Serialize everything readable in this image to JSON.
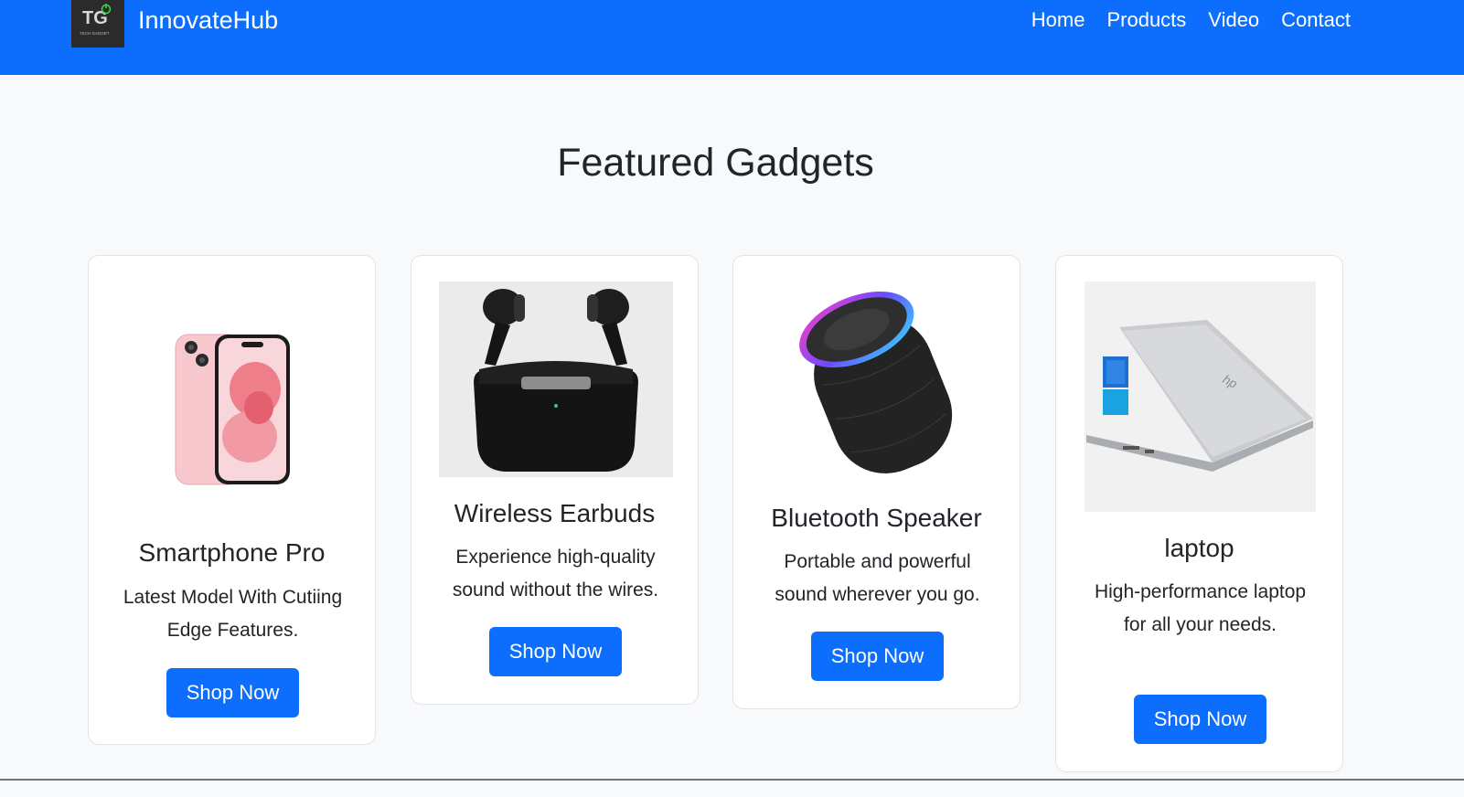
{
  "header": {
    "logo_text": "TG",
    "logo_subtext": "TECH GADGET",
    "brand": "InnovateHub",
    "nav": [
      "Home",
      "Products",
      "Video",
      "Contact"
    ]
  },
  "main": {
    "title": "Featured Gadgets",
    "cards": [
      {
        "title": "Smartphone Pro",
        "description": "Latest Model With Cutiing Edge Features.",
        "button": "Shop Now",
        "image": "pink-smartphone"
      },
      {
        "title": "Wireless Earbuds",
        "description": "Experience high-quality sound without the wires.",
        "button": "Shop Now",
        "image": "black-earbuds-case"
      },
      {
        "title": "Bluetooth Speaker",
        "description": "Portable and powerful sound wherever you go.",
        "button": "Shop Now",
        "image": "black-speaker-rgb-ring"
      },
      {
        "title": "laptop",
        "description": "High-performance laptop for all your needs.",
        "button": "Shop Now",
        "image": "silver-laptop"
      }
    ]
  },
  "colors": {
    "primary": "#0d6efd",
    "background": "#f8f9fa",
    "card": "#ffffff",
    "text": "#212529"
  }
}
